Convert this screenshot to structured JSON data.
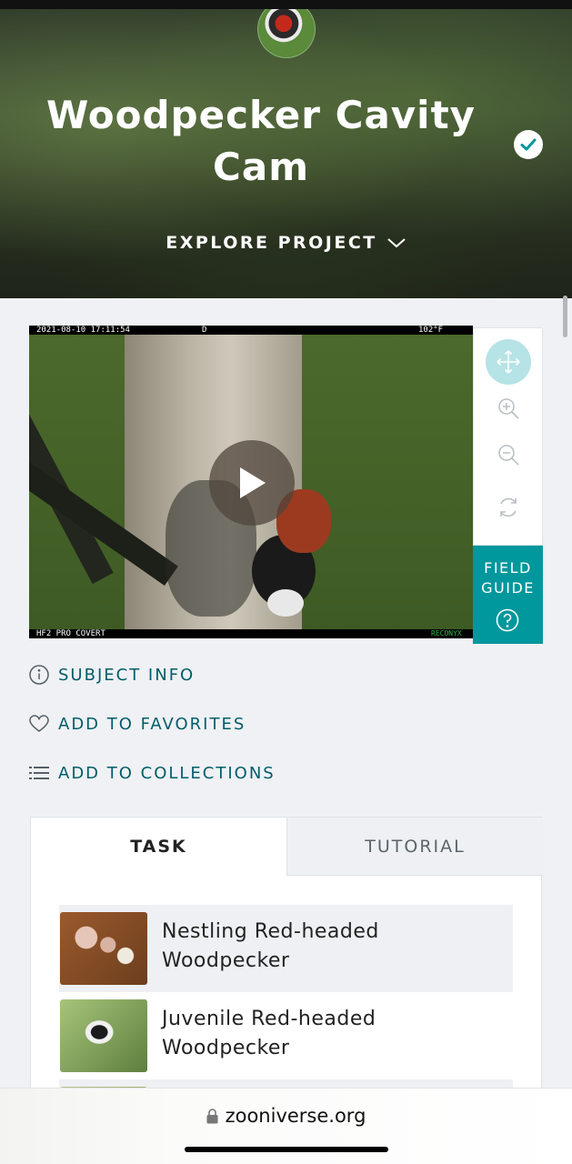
{
  "project": {
    "title": "Woodpecker Cavity Cam",
    "explore_label": "EXPLORE PROJECT",
    "verified_icon": "checkmark-badge-icon",
    "accent_color": "#00979d"
  },
  "subject": {
    "overlay": {
      "timestamp": "2021-08-10 17:11:54",
      "mode": "D",
      "temperature": "102°F",
      "camera_model": "HF2 PRO COVERT",
      "brand": "RECONYX"
    }
  },
  "tools": [
    {
      "name": "move",
      "icon": "move-arrows-icon",
      "active": true
    },
    {
      "name": "zoom-in",
      "icon": "zoom-in-icon",
      "active": false
    },
    {
      "name": "zoom-out",
      "icon": "zoom-out-icon",
      "active": false
    },
    {
      "name": "rotate",
      "icon": "rotate-icon",
      "active": false
    }
  ],
  "field_guide": {
    "label_line1": "FIELD",
    "label_line2": "GUIDE"
  },
  "actions": {
    "subject_info": "SUBJECT INFO",
    "add_favorites": "ADD TO FAVORITES",
    "add_collections": "ADD TO COLLECTIONS"
  },
  "tabs": {
    "task": "TASK",
    "tutorial": "TUTORIAL"
  },
  "choices": [
    {
      "line1": "Nestling Red-headed",
      "line2": "Woodpecker"
    },
    {
      "line1": "Juvenile Red-headed",
      "line2": "Woodpecker"
    }
  ],
  "browser": {
    "url": "zooniverse.org"
  }
}
